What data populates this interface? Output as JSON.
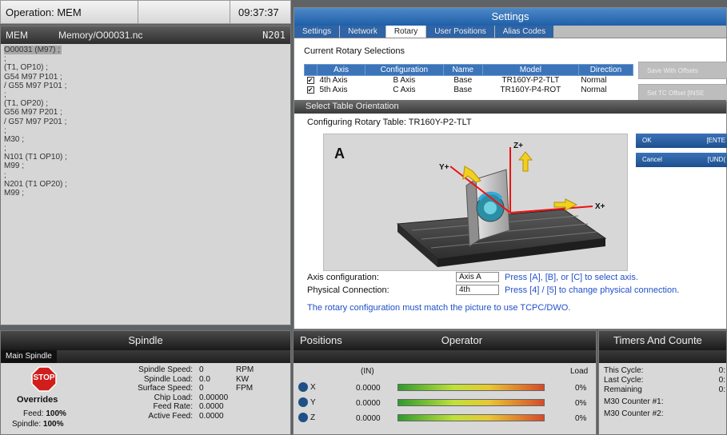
{
  "header": {
    "operation": "Operation: MEM",
    "time": "09:37:37"
  },
  "program": {
    "mode": "MEM",
    "path": "Memory/O00031.nc",
    "block": "N201",
    "lines": [
      "O00031 (M97) ;",
      ";",
      "(T1, OP10) ;",
      "G54 M97 P101 ;",
      "/ G55 M97 P101 ;",
      ";",
      "(T1, OP20) ;",
      "G56 M97 P201 ;",
      "/ G57 M97 P201 ;",
      ";",
      "M30 ;",
      ";",
      "N101 (T1 OP10) ;",
      "M99 ;",
      ";",
      "N201 (T1 OP20) ;",
      "M99 ;"
    ]
  },
  "settings": {
    "title": "Settings",
    "tabs": [
      "Settings",
      "Network",
      "Rotary",
      "User Positions",
      "Alias Codes"
    ],
    "current_label": "Current Rotary Selections",
    "columns": [
      "Axis",
      "Configuration",
      "Name",
      "Model",
      "Direction"
    ],
    "rows": [
      {
        "checked": "✔",
        "axis": "4th Axis",
        "config": "B Axis",
        "name": "Base",
        "model": "TR160Y-P2-TLT",
        "direction": "Normal"
      },
      {
        "checked": "✔",
        "axis": "5th Axis",
        "config": "C Axis",
        "name": "Base",
        "model": "TR160Y-P4-ROT",
        "direction": "Normal"
      }
    ],
    "btn_save_offsets": "Save With Offsets",
    "btn_set_tc": "Set TC Offset [INSE",
    "orient_title": "Select Table Orientation",
    "configuring": "Configuring Rotary Table: TR160Y-P2-TLT",
    "picture": {
      "letter": "A",
      "z": "Z+",
      "y": "Y+",
      "x": "X+"
    },
    "ok": {
      "label": "OK",
      "key": "[ENTE"
    },
    "cancel": {
      "label": "Cancel",
      "key": "[UND("
    },
    "axis_conf_label": "Axis configuration:",
    "axis_conf_value": "Axis A",
    "axis_conf_hint": "Press [A], [B], or [C] to select axis.",
    "phys_label": "Physical Connection:",
    "phys_value": "4th",
    "phys_hint": "Press [4] / [5] to change physical connection.",
    "note": "The rotary configuration must match the picture to use TCPC/DWO."
  },
  "spindle": {
    "title": "Spindle",
    "tab": "Main Spindle",
    "stop": "STOP",
    "overrides": "Overrides",
    "feed_label": "Feed:",
    "feed_val": "100%",
    "spindle_label": "Spindle:",
    "spindle_val": "100%",
    "stats": [
      {
        "label": "Spindle Speed:",
        "value": "0",
        "unit": "RPM"
      },
      {
        "label": "Spindle Load:",
        "value": "0.0",
        "unit": "KW"
      },
      {
        "label": "Surface Speed:",
        "value": "0",
        "unit": "FPM"
      },
      {
        "label": "Chip Load:",
        "value": "0.00000",
        "unit": ""
      },
      {
        "label": "Feed Rate:",
        "value": "0.0000",
        "unit": ""
      },
      {
        "label": "Active Feed:",
        "value": "0.0000",
        "unit": ""
      }
    ]
  },
  "positions": {
    "title": "Positions",
    "operator": "Operator",
    "units": "(IN)",
    "load": "Load",
    "axes": [
      {
        "axis": "X",
        "value": "0.0000",
        "load": "0%"
      },
      {
        "axis": "Y",
        "value": "0.0000",
        "load": "0%"
      },
      {
        "axis": "Z",
        "value": "0.0000",
        "load": "0%"
      }
    ]
  },
  "timers": {
    "title": "Timers And Counte",
    "rows": [
      {
        "label": "This Cycle:",
        "value": "0:"
      },
      {
        "label": "Last Cycle:",
        "value": "0:"
      },
      {
        "label": "Remaining",
        "value": "0:"
      },
      {
        "label": "M30 Counter #1:",
        "value": ""
      },
      {
        "label": "M30 Counter #2:",
        "value": ""
      }
    ]
  }
}
